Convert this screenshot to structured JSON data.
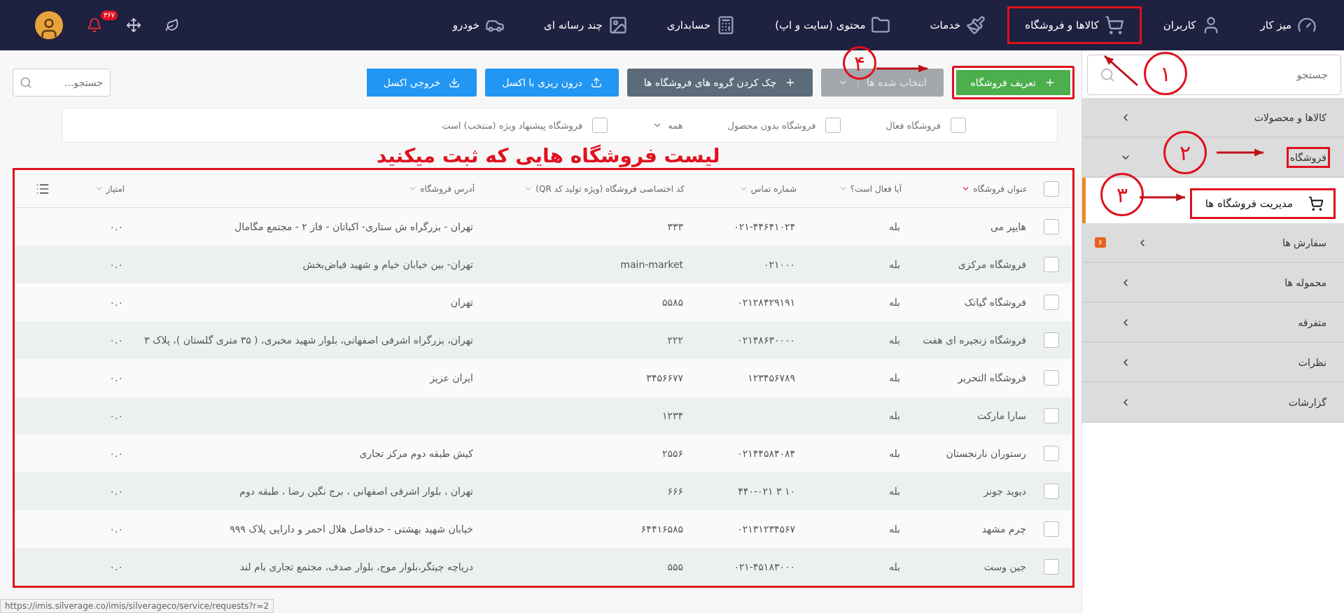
{
  "top_nav": {
    "items": [
      {
        "label": "میز کار",
        "highlighted": false
      },
      {
        "label": "کاربران",
        "highlighted": false
      },
      {
        "label": "کالاها و فروشگاه",
        "highlighted": true
      },
      {
        "label": "خدمات",
        "highlighted": false
      },
      {
        "label": "محتوی (سایت و اپ)",
        "highlighted": false
      },
      {
        "label": "حسابداری",
        "highlighted": false
      },
      {
        "label": "چند رسانه ای",
        "highlighted": false
      },
      {
        "label": "خودرو",
        "highlighted": false
      }
    ],
    "notifications_badge": "۳۶۷"
  },
  "sidebar": {
    "search": {
      "placeholder": "جستجو"
    },
    "items": [
      {
        "label": "کالاها و محصولات",
        "expanded": false,
        "highlighted": false
      },
      {
        "label": "فروشگاه",
        "expanded": true,
        "highlighted": true,
        "children": [
          {
            "label": "مدیریت فروشگاه ها",
            "selected": true,
            "highlighted": true
          }
        ]
      },
      {
        "label": "سفارش ها",
        "expanded": false,
        "highlighted": false,
        "badge": "۶"
      },
      {
        "label": "محموله ها",
        "expanded": false,
        "highlighted": false
      },
      {
        "label": "متفرقه",
        "expanded": false,
        "highlighted": false
      },
      {
        "label": "نظرات",
        "expanded": false,
        "highlighted": false
      },
      {
        "label": "گزارشات",
        "expanded": false,
        "highlighted": false
      }
    ]
  },
  "toolbar": {
    "buttons": [
      {
        "label": "تعریف فروشگاه",
        "kind": "add",
        "disabled": false,
        "highlighted": true
      },
      {
        "label": "انتخاب شده ها",
        "kind": "menu",
        "disabled": true,
        "highlighted": false
      },
      {
        "label": "چک کردن گروه های فروشگاه ها",
        "kind": "check",
        "disabled": false,
        "highlighted": false
      },
      {
        "label": "درون ریزی با اکسل",
        "kind": "import",
        "disabled": false,
        "highlighted": false
      },
      {
        "label": "خروجی اکسل",
        "kind": "export",
        "disabled": false,
        "highlighted": false
      }
    ],
    "search": {
      "placeholder": "جستجو..."
    }
  },
  "filters": [
    {
      "kind": "checkbox",
      "label": "فروشگاه فعال",
      "checked": false
    },
    {
      "kind": "checkbox",
      "label": "فروشگاه بدون محصول",
      "checked": false
    },
    {
      "kind": "dropdown",
      "label": "همه"
    },
    {
      "kind": "checkbox",
      "label": "فروشگاه پیشنهاد ویژه (منتخب) است",
      "checked": false
    }
  ],
  "annotation_caption": "لیست فروشگاه هایی که ثبت میکنید",
  "annotations": [
    {
      "label": "۱"
    },
    {
      "label": "۲"
    },
    {
      "label": "۳"
    },
    {
      "label": "۴"
    }
  ],
  "table": {
    "highlighted": true,
    "columns": [
      {
        "label": "عنوان فروشگاه",
        "sorted": true
      },
      {
        "label": "آیا فعال است؟",
        "sorted": false
      },
      {
        "label": "شماره تماس",
        "sorted": false
      },
      {
        "label": "کد اختصاصی فروشگاه (ویژه تولید کد QR)",
        "sorted": false
      },
      {
        "label": "آدرس فروشگاه",
        "sorted": false
      },
      {
        "label": "امتیاز",
        "sorted": false
      }
    ],
    "rows": [
      {
        "checked": false,
        "cells": [
          "هایپر می",
          "بله",
          "۰۲۱-۴۴۶۴۱۰۲۴",
          "۳۳۳",
          "تهران - بزرگراه ش ستاری- اکباتان - فاز ۲ - مجتمع مگامال",
          "۰.۰"
        ]
      },
      {
        "checked": false,
        "cells": [
          "فروشگاه مرکزی",
          "بله",
          "۰۲۱۰۰۰",
          "main-market",
          "تهران- بین خیابان خیام و شهید فیاض‌بخش",
          "۰.۰"
        ]
      },
      {
        "checked": false,
        "cells": [
          "فروشگاه گیاتک",
          "بله",
          "۰۲۱۲۸۴۲۹۱۹۱",
          "۵۵۸۵",
          "تهران",
          "۰.۰"
        ]
      },
      {
        "checked": false,
        "cells": [
          "فروشگاه زنجیره ای هفت",
          "بله",
          "۰۲۱۴۸۶۳۰۰۰۰",
          "۲۲۲",
          "تهران، بزرگراه اشرفی اصفهانی، بلوار شهید مخبری، ( ۳۵ متری گلستان )، پلاک ۳",
          "۰.۰"
        ]
      },
      {
        "checked": false,
        "cells": [
          "فروشگاه التحریر",
          "بله",
          "۱۲۳۴۵۶۷۸۹",
          "۳۴۵۶۶۷۷",
          "ایران عزیز",
          "۰.۰"
        ]
      },
      {
        "checked": false,
        "cells": [
          "سارا مارکت",
          "بله",
          "",
          "۱۲۳۴",
          "",
          "۰.۰"
        ]
      },
      {
        "checked": false,
        "cells": [
          "رستوران نارنجستان",
          "بله",
          "۰۲۱۴۴۵۸۴۰۸۴",
          "۲۵۵۶",
          "کیش طبقه دوم مرکز تجاری",
          "۰.۰"
        ]
      },
      {
        "checked": false,
        "cells": [
          "دیوید جونز",
          "بله",
          "۱۰ ۳ ۴۴۰-۰۲۱",
          "۶۶۶",
          "تهران ، بلوار اشرفی اصفهانی ، برج نگین رضا ، طبقه دوم",
          "۰.۰"
        ]
      },
      {
        "checked": false,
        "cells": [
          "چرم مشهد",
          "بله",
          "۰۲۱۳۱۲۳۴۵۶۷",
          "۶۴۴۱۶۵۸۵",
          "خیابان شهید بهشتی - حدفاصل هلال احمر و دارایی پلاک ۹۹۹",
          "۰.۰"
        ]
      },
      {
        "checked": false,
        "cells": [
          "جین وست",
          "بله",
          "۰۲۱-۴۵۱۸۳۰۰۰",
          "۵۵۵",
          "دریاچه چیتگر،بلوار موج، بلوار صدف، مجتمع تجاری بام لند",
          "۰.۰"
        ]
      }
    ]
  },
  "status_url": "https://imis.silverage.co/imis/silverageco/service/requests?r=2"
}
